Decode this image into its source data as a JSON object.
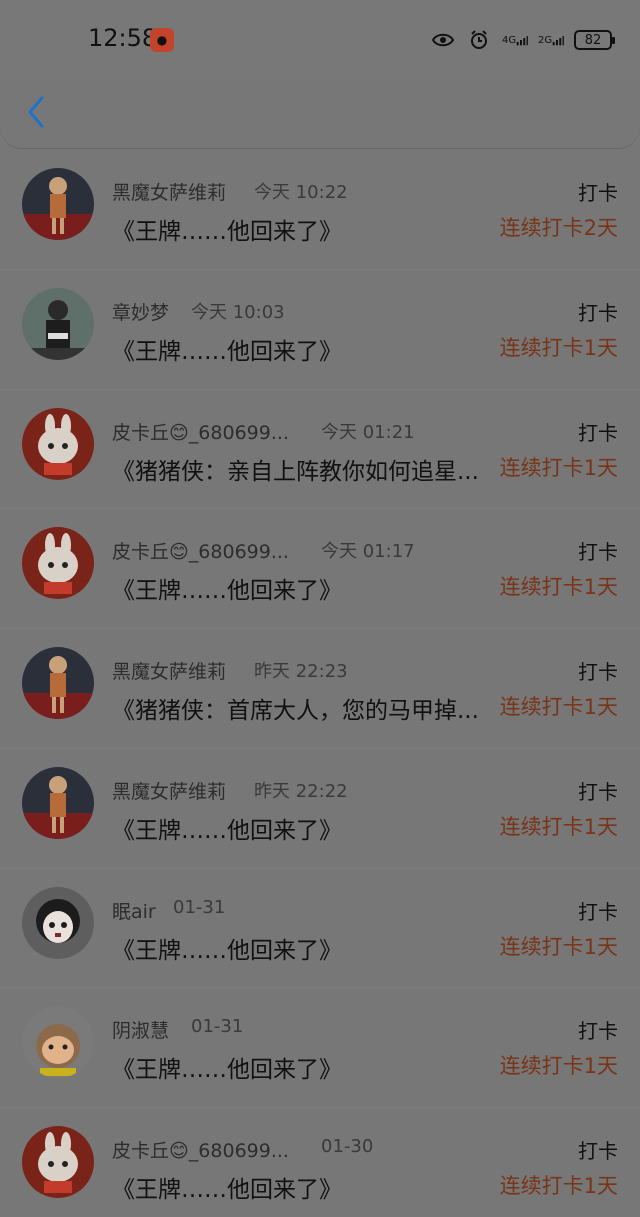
{
  "status_bar": {
    "time": "12:58",
    "battery": "82",
    "net1": "4G",
    "net2": "2G",
    "icons": [
      "eye-icon",
      "alarm-icon",
      "signal-icon",
      "signal-icon",
      "battery-icon"
    ]
  },
  "header": {
    "back_icon": "chevron-left-icon",
    "accent": "#1d73c6"
  },
  "rows": [
    {
      "name": "黑魔女萨维莉",
      "time": "今天 10:22",
      "right": "打卡",
      "title": "《王牌……他回来了》",
      "streak": "连续打卡2天"
    },
    {
      "name": "章妙梦",
      "time": "今天 10:03",
      "right": "打卡",
      "title": "《王牌……他回来了》",
      "streak": "连续打卡1天"
    },
    {
      "name": "皮卡丘😊_680699...",
      "time": "今天 01:21",
      "right": "打卡",
      "title": "《猪猪侠：亲自上阵教你如何追星...",
      "streak": "连续打卡1天"
    },
    {
      "name": "皮卡丘😊_680699...",
      "time": "今天 01:17",
      "right": "打卡",
      "title": "《王牌……他回来了》",
      "streak": "连续打卡1天"
    },
    {
      "name": "黑魔女萨维莉",
      "time": "昨天 22:23",
      "right": "打卡",
      "title": "《猪猪侠：首席大人，您的马甲掉...",
      "streak": "连续打卡1天"
    },
    {
      "name": "黑魔女萨维莉",
      "time": "昨天 22:22",
      "right": "打卡",
      "title": "《王牌……他回来了》",
      "streak": "连续打卡1天"
    },
    {
      "name": "眠air",
      "time": "01-31",
      "right": "打卡",
      "title": "《王牌……他回来了》",
      "streak": "连续打卡1天"
    },
    {
      "name": "阴淑慧",
      "time": "01-31",
      "right": "打卡",
      "title": "《王牌……他回来了》",
      "streak": "连续打卡1天"
    },
    {
      "name": "皮卡丘😊_680699...",
      "time": "01-30",
      "right": "打卡",
      "title": "《王牌……他回来了》",
      "streak": "连续打卡1天"
    }
  ]
}
